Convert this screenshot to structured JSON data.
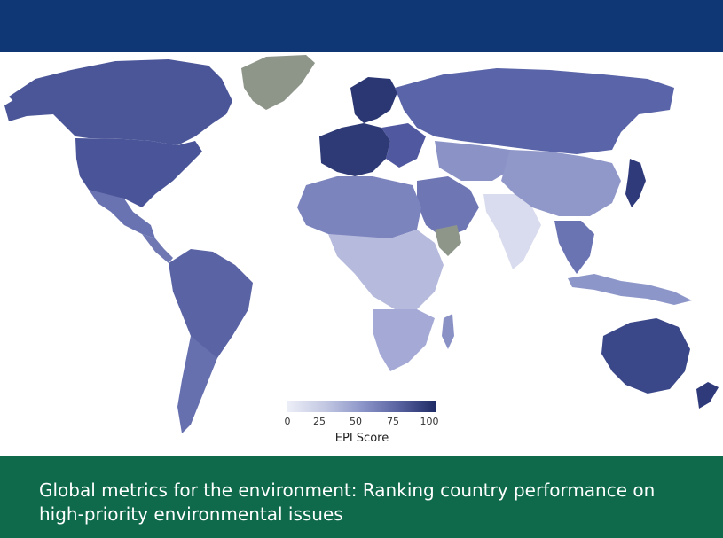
{
  "legend": {
    "title": "EPI Score",
    "ticks": [
      "0",
      "25",
      "50",
      "75",
      "100"
    ],
    "colors": [
      "#eceef7",
      "#c3c8e2",
      "#8d96c9",
      "#57619f",
      "#1d2a63"
    ]
  },
  "caption": {
    "text": "Global metrics for the environment: Ranking country performance on high-priority environmental issues"
  },
  "colors": {
    "top_band": "#0f3675",
    "bottom_band": "#0e6a4a",
    "no_data": "#8e968a"
  }
}
